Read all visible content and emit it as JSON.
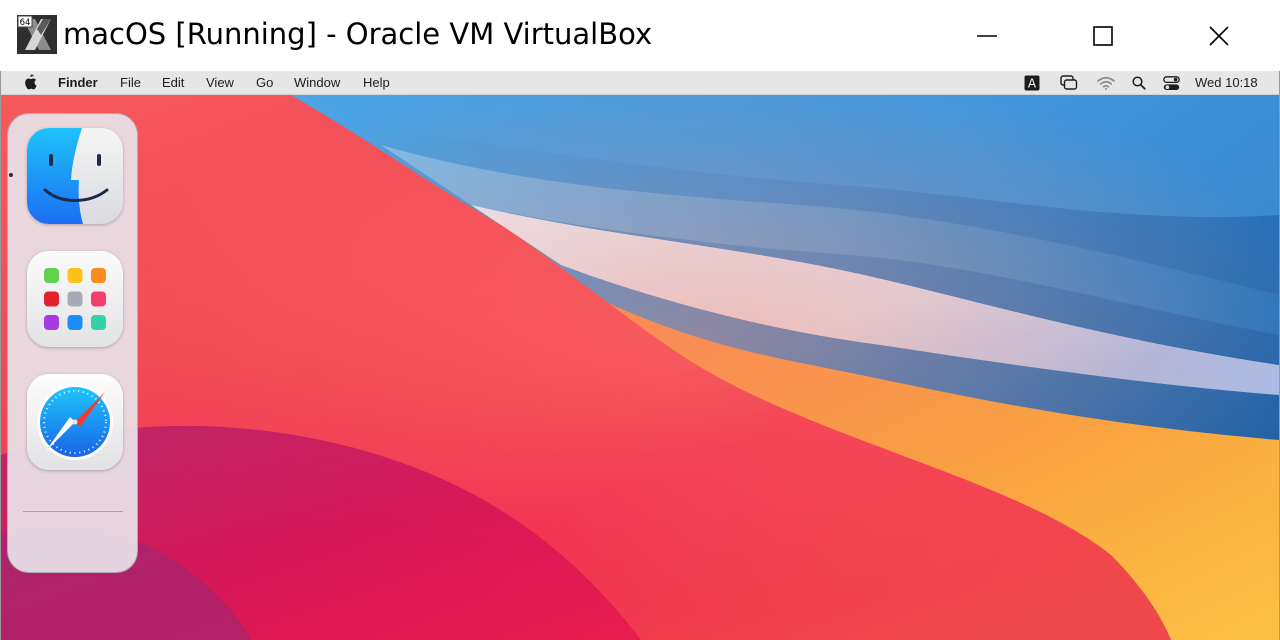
{
  "window": {
    "title": "macOS [Running] - Oracle VM VirtualBox",
    "icon": "virtualbox-vm-icon",
    "icon_badge": "64",
    "controls": [
      "minimize-icon",
      "maximize-icon",
      "close-icon"
    ]
  },
  "menubar": {
    "apple_icon": "apple-icon",
    "items": [
      {
        "label": "Finder"
      },
      {
        "label": "File"
      },
      {
        "label": "Edit"
      },
      {
        "label": "View"
      },
      {
        "label": "Go"
      },
      {
        "label": "Window"
      },
      {
        "label": "Help"
      }
    ],
    "status": {
      "input_source_label": "A",
      "icons": [
        "input-source-icon",
        "screen-mirroring-icon",
        "wifi-icon",
        "spotlight-search-icon",
        "control-center-icon"
      ],
      "clock": "Wed 10:18"
    }
  },
  "dock": {
    "apps": [
      {
        "name": "Finder",
        "icon": "finder-icon",
        "running": true
      },
      {
        "name": "Launchpad",
        "icon": "launchpad-icon",
        "running": false
      },
      {
        "name": "Safari",
        "icon": "safari-icon",
        "running": false
      }
    ]
  },
  "colors": {
    "menubar_bg": "#e6e6e6",
    "wallpaper_red": "#ee2a4d",
    "wallpaper_orange": "#f7a23c",
    "wallpaper_blue": "#2f86cf"
  }
}
